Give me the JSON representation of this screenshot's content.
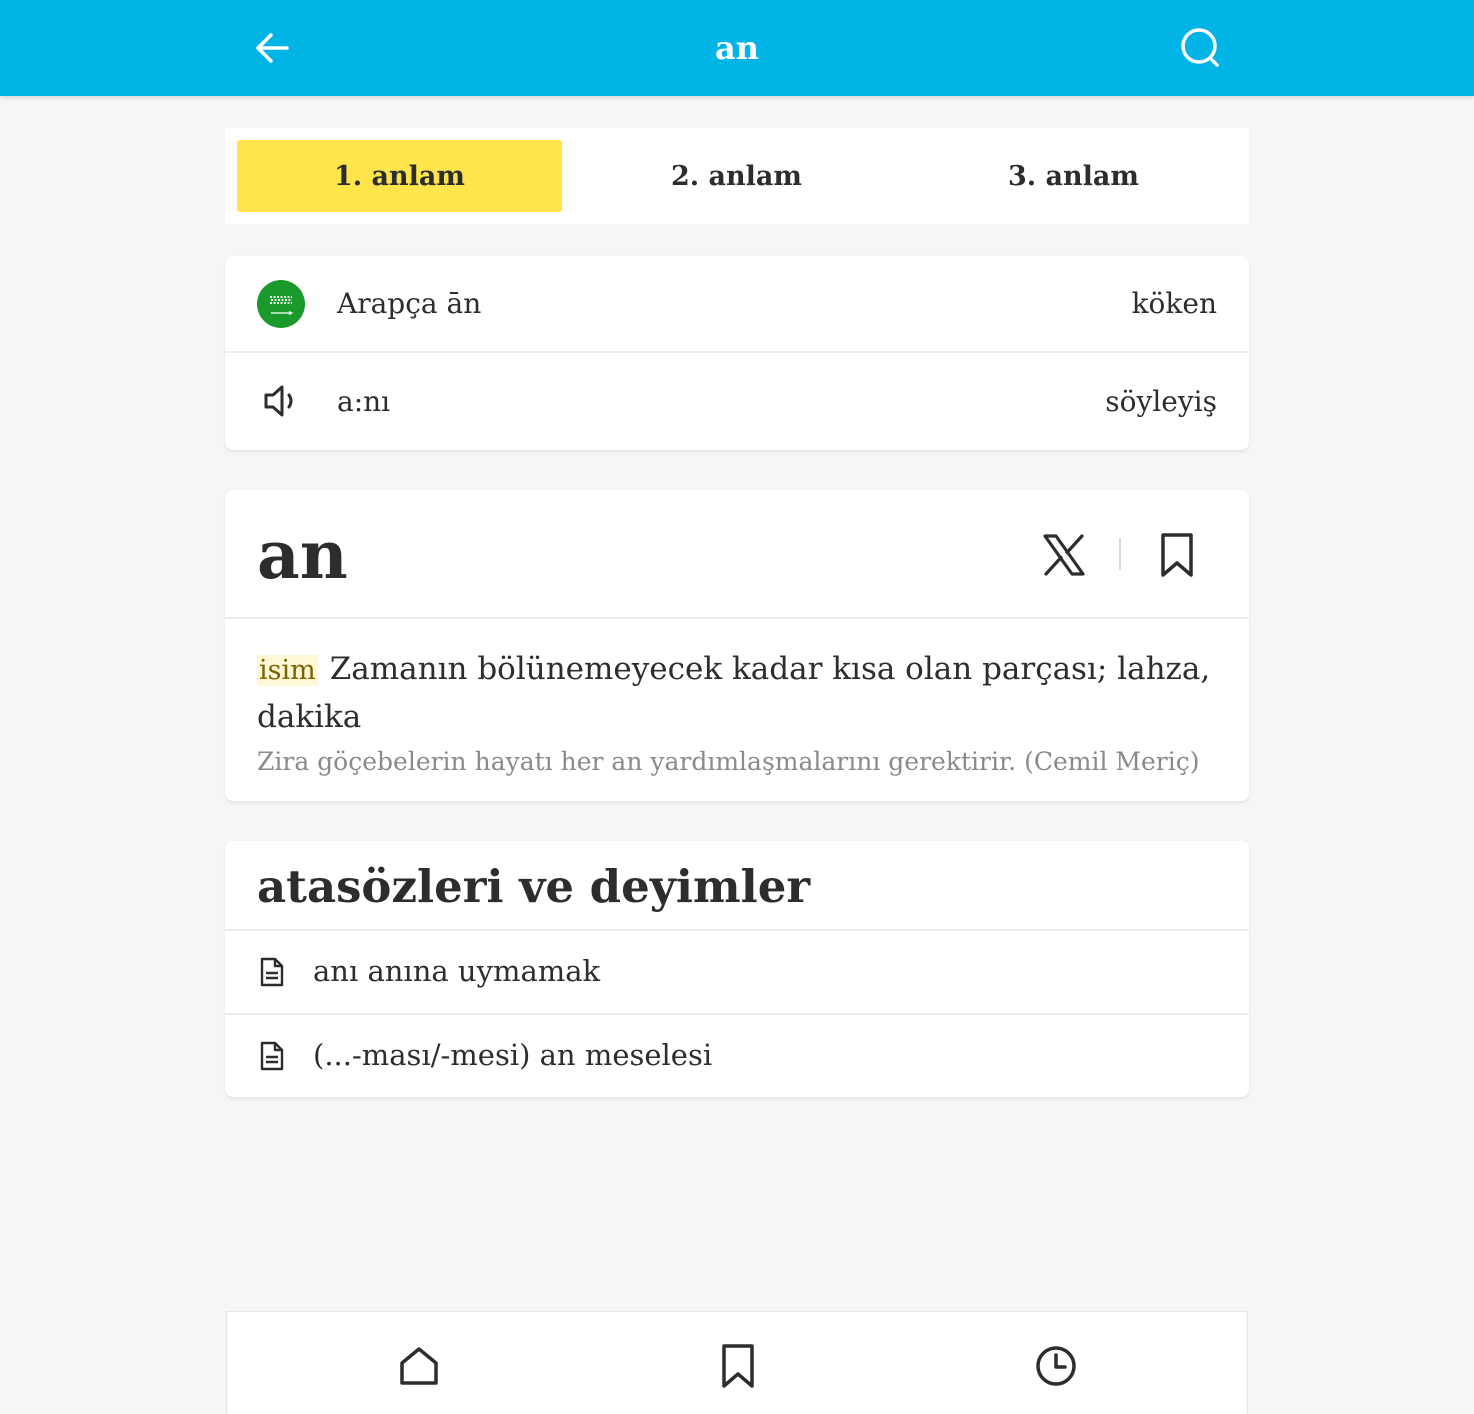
{
  "header": {
    "title": "an",
    "back_icon": "arrow-left-icon",
    "search_icon": "search-icon",
    "background_color": "#00b4e6"
  },
  "tabs": [
    {
      "label": "1. anlam",
      "active": true
    },
    {
      "label": "2. anlam",
      "active": false
    },
    {
      "label": "3. anlam",
      "active": false
    }
  ],
  "info": {
    "origin": {
      "value": "Arapça ān",
      "label": "köken",
      "icon": "saudi-flag-icon"
    },
    "pronunciation": {
      "value": "a:nı",
      "label": "söyleyiş",
      "icon": "speaker-icon"
    }
  },
  "definition": {
    "word": "an",
    "part_of_speech": "isim",
    "text": "Zamanın bölünemeyecek kadar kısa olan parçası; lahza, dakika",
    "example": "Zira göçebelerin hayatı her an yardımlaşmalarını gerektirir. (Cemil Meriç)",
    "share_icon": "x-logo-icon",
    "bookmark_icon": "bookmark-icon"
  },
  "idioms": {
    "title": "atasözleri ve deyimler",
    "items": [
      {
        "text": "anı anına uymamak",
        "icon": "document-icon"
      },
      {
        "text": "(...-ması/-mesi) an meselesi",
        "icon": "document-icon"
      }
    ]
  },
  "bottom_nav": [
    {
      "name": "home",
      "icon": "home-icon"
    },
    {
      "name": "saved",
      "icon": "bookmark-icon"
    },
    {
      "name": "history",
      "icon": "clock-icon"
    }
  ],
  "colors": {
    "accent": "#00b4e6",
    "active_tab": "#ffe54c",
    "pos_highlight": "#fff8d6"
  }
}
